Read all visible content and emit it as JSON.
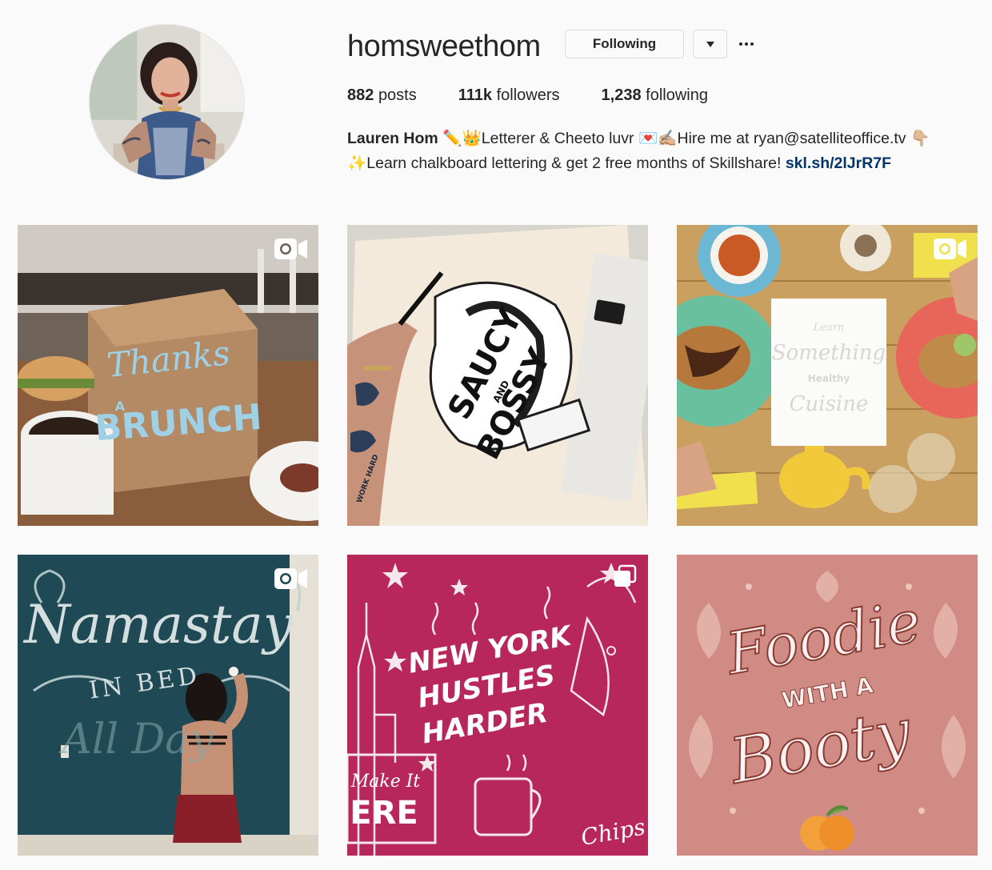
{
  "profile": {
    "username": "homsweethom",
    "following_button": "Following",
    "stats": {
      "posts_count": "882",
      "posts_label": "posts",
      "followers_count": "111k",
      "followers_label": "followers",
      "following_count": "1,238",
      "following_label": "following"
    },
    "bio": {
      "name": "Lauren Hom",
      "line1_emoji_a": "✏️👑",
      "line1_text_a": "Letterer & Cheeto luvr ",
      "line1_emoji_b": "💌✍🏼",
      "line1_text_b": "Hire me at ryan@satelliteoffice.tv ",
      "line1_emoji_c": "👇🏼",
      "line2_emoji": "✨",
      "line2_text": "Learn chalkboard lettering & get 2 free months of Skillshare! ",
      "link": "skl.sh/2lJrR7F"
    }
  },
  "posts": [
    {
      "art_line1": "Thanks",
      "art_line2": "A",
      "art_line3": "BRUNCH",
      "badge": "video-icon"
    },
    {
      "art_line1": "SAUCY",
      "art_line2": "AND",
      "art_line3": "BOSSY",
      "art_tattoo": "WORK HARD",
      "badge": "none"
    },
    {
      "art_line1": "Learn",
      "art_line2": "Something",
      "art_line3": "Healthy",
      "art_line4": "Cuisine",
      "badge": "video-icon"
    },
    {
      "art_line1": "Namastay",
      "art_line2": "IN BED",
      "art_line3": "All Day",
      "badge": "video-icon"
    },
    {
      "art_line1": "NEW YORK",
      "art_line2": "HUSTLES",
      "art_line3": "HARDER",
      "art_line4": "Make It",
      "art_line5": "ERE",
      "art_line6": "Chips",
      "badge": "carousel-icon"
    },
    {
      "art_line1": "Foodie",
      "art_line2": "WITH A",
      "art_line3": "Booty",
      "badge": "none"
    }
  ],
  "colors": {
    "background": "#fafafa",
    "text": "#262626",
    "link": "#003569",
    "border": "#dbdbdb"
  }
}
